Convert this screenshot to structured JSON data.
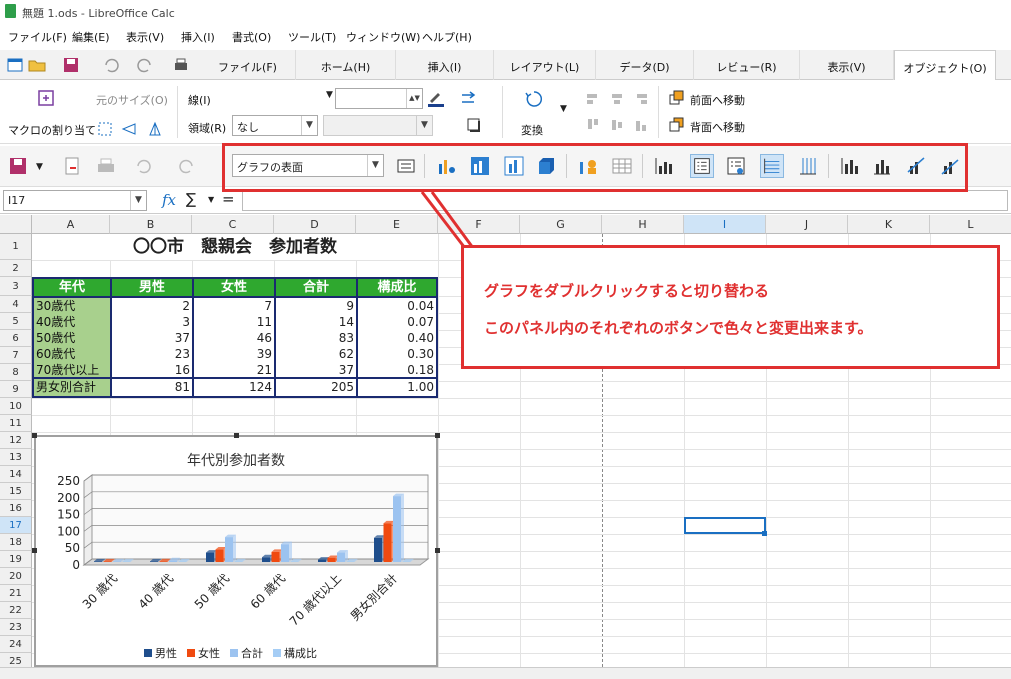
{
  "window": {
    "title": "無題 1.ods - LibreOffice Calc"
  },
  "menu": [
    "ファイル(F)",
    "編集(E)",
    "表示(V)",
    "挿入(I)",
    "書式(O)",
    "ツール(T)",
    "ウィンドウ(W)",
    "ヘルプ(H)"
  ],
  "tabs": [
    "ファイル(F)",
    "ホーム(H)",
    "挿入(I)",
    "レイアウト(L)",
    "データ(D)",
    "レビュー(R)",
    "表示(V)",
    "オブジェクト(O)"
  ],
  "ribbon": {
    "macro_label": "マクロの割り当て",
    "orig_size_label": "元のサイズ(O)",
    "line_label": "線(I)",
    "area_label": "領域(R)",
    "area_value": "なし",
    "transform_label": "変換",
    "bring_front_label": "前面へ移動",
    "send_back_label": "背面へ移動"
  },
  "chart_toolbar": {
    "element_select": "グラフの表面"
  },
  "formula": {
    "cell_ref": "I17",
    "fx": "fx",
    "sigma": "∑",
    "equals": "="
  },
  "columns": [
    "A",
    "B",
    "C",
    "D",
    "E",
    "F",
    "G",
    "H",
    "I",
    "J",
    "K",
    "L"
  ],
  "rows": [
    "1",
    "2",
    "3",
    "4",
    "5",
    "6",
    "7",
    "8",
    "9",
    "10",
    "11",
    "12",
    "13",
    "14",
    "15",
    "16",
    "17",
    "18",
    "19",
    "20",
    "21",
    "22",
    "23",
    "24",
    "25"
  ],
  "sheet": {
    "title": "〇〇市　懇親会　参加者数",
    "headers": [
      "年代",
      "男性",
      "女性",
      "合計",
      "構成比"
    ],
    "data": [
      [
        "30歳代",
        "2",
        "7",
        "9",
        "0.04"
      ],
      [
        "40歳代",
        "3",
        "11",
        "14",
        "0.07"
      ],
      [
        "50歳代",
        "37",
        "46",
        "83",
        "0.40"
      ],
      [
        "60歳代",
        "23",
        "39",
        "62",
        "0.30"
      ],
      [
        "70歳代以上",
        "16",
        "21",
        "37",
        "0.18"
      ],
      [
        "男女別合計",
        "81",
        "124",
        "205",
        "1.00"
      ]
    ]
  },
  "callout": {
    "line1": "グラフをダブルクリックすると切り替わる",
    "line2": "このパネル内のそれぞれのボタンで色々と変更出来ます。"
  },
  "colors": {
    "accent_red": "#e03030",
    "header_green": "#2fa82f",
    "age_green": "#a8d08d",
    "series_male": "#1f4e8c",
    "series_female": "#f04a10",
    "series_total": "#9cc3f0",
    "series_ratio": "#a5cdf5"
  },
  "chart_data": {
    "type": "bar",
    "title": "年代別参加者数",
    "categories": [
      "30 歳代",
      "40 歳代",
      "50 歳代",
      "60 歳代",
      "70 歳代以上",
      "男女別合計"
    ],
    "series": [
      {
        "name": "男性",
        "values": [
          2,
          3,
          37,
          23,
          16,
          81
        ]
      },
      {
        "name": "女性",
        "values": [
          7,
          11,
          46,
          39,
          21,
          124
        ]
      },
      {
        "name": "合計",
        "values": [
          9,
          14,
          83,
          62,
          37,
          205
        ]
      },
      {
        "name": "構成比",
        "values": [
          0.04,
          0.07,
          0.4,
          0.3,
          0.18,
          1.0
        ]
      }
    ],
    "yticks": [
      "0",
      "50",
      "100",
      "150",
      "200",
      "250"
    ],
    "ylim": [
      0,
      250
    ],
    "legend": "bottom"
  }
}
